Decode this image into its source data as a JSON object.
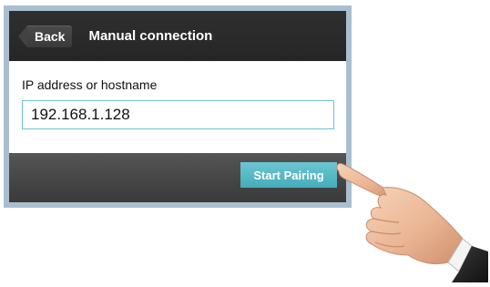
{
  "header": {
    "back_label": "Back",
    "title": "Manual connection"
  },
  "form": {
    "field_label": "IP address or hostname",
    "ip_value": "192.168.1.128"
  },
  "footer": {
    "start_label": "Start Pairing"
  },
  "colors": {
    "header_bg": "#2b2b2b",
    "accent": "#5bbcc8",
    "frame": "#a9bfd0"
  },
  "overlay": {
    "icon": "pointing-hand-icon"
  }
}
